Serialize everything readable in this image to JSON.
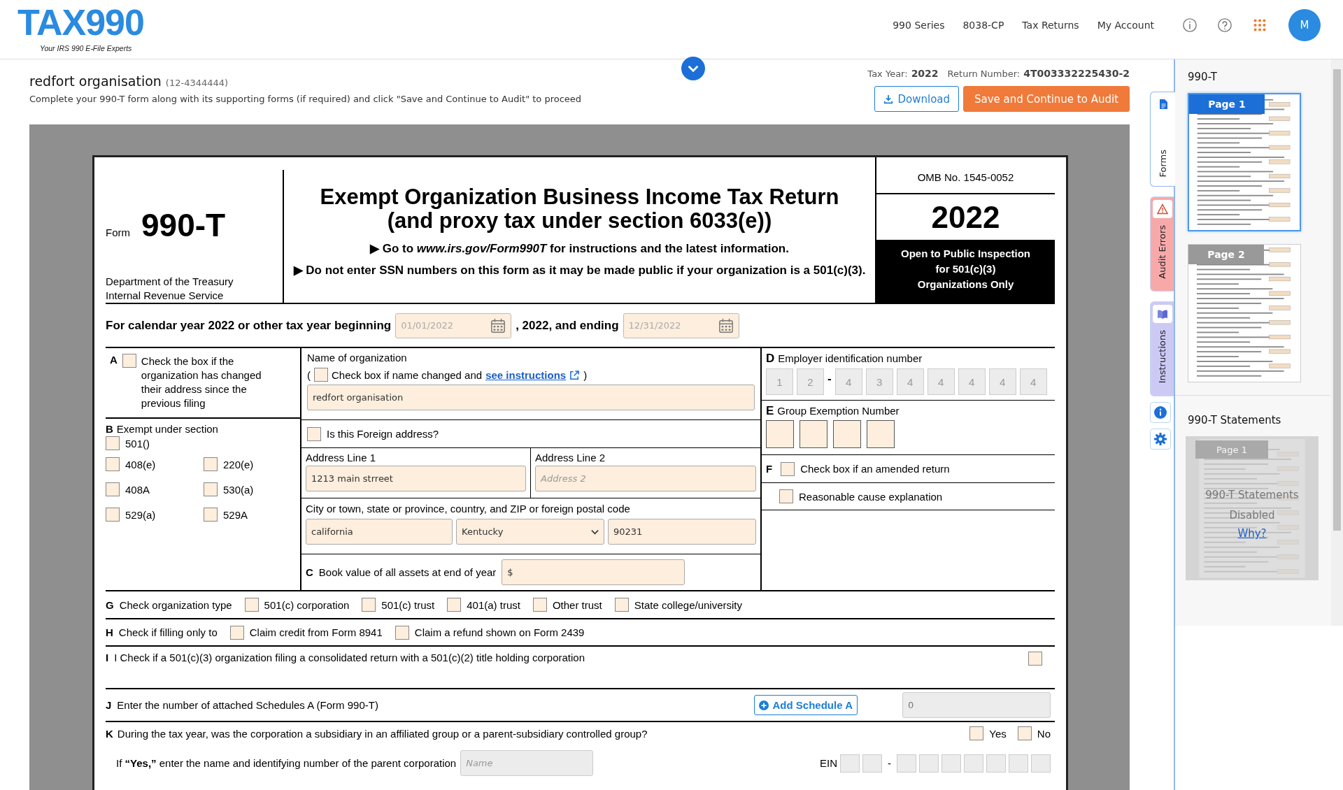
{
  "header": {
    "logo": "TAX990",
    "tagline": "Your IRS 990 E-File Experts",
    "nav": [
      "990 Series",
      "8038-CP",
      "Tax Returns",
      "My Account"
    ],
    "avatar": "M"
  },
  "return": {
    "org_name": "redfort organisation",
    "ein": "(12-4344444)",
    "hint": "Complete your 990-T form along with its supporting forms (if required) and click \"Save and Continue to Audit\" to proceed",
    "tax_year_label": "Tax Year:",
    "tax_year": "2022",
    "return_number_label": "Return Number:",
    "return_number": "4T003332225430-2",
    "buttons": [
      {
        "label": "Download",
        "kind": "outline"
      },
      {
        "label": "Save and Continue to Audit",
        "kind": "primary"
      }
    ]
  },
  "form": {
    "form_label": "Form",
    "form_number": "990-T",
    "department": "Department of the Treasury\nInternal Revenue Service",
    "title": "Exempt Organization Business Income Tax Return\n(and proxy tax under section 6033(e))",
    "goto": "▶ Go to *www.irs.gov/Form990T* for instructions and the latest information.",
    "ssn_note": "▶ Do not enter SSN numbers on this form as it may be made public if your organization is a 501(c)(3).",
    "omb": "OMB No. 1545-0052",
    "year": "2022",
    "inspection": "Open to Public Inspection\nfor 501(c)(3)\nOrganizations Only",
    "dates": {
      "label": "For calendar year 2022 or other tax year beginning",
      "begin": "01/01/2022",
      "middle": ", 2022, and ending",
      "end": "12/31/2022"
    },
    "a": {
      "letter": "A",
      "text": "Check the box if the organization has changed their address since the previous filing",
      "checked": false
    },
    "b": {
      "letter": "B",
      "label": "Exempt under section",
      "options": [
        {
          "label": "501()",
          "checked": false
        },
        {
          "label": "408(e)",
          "checked": false
        },
        {
          "label": "220(e)",
          "checked": false
        },
        {
          "label": "408A",
          "checked": false
        },
        {
          "label": "530(a)",
          "checked": false
        },
        {
          "label": "529(a)",
          "checked": false
        },
        {
          "label": "529A",
          "checked": false
        }
      ]
    },
    "name": {
      "label": "Name of organization",
      "open": "(",
      "text": "Check box if name changed and",
      "link": "see instructions",
      "close": ")",
      "checked": false,
      "value": "redfort organisation"
    },
    "foreign": {
      "text": "Is this Foreign address?",
      "checked": false
    },
    "address1": {
      "label": "Address Line 1",
      "value": "1213 main strreet"
    },
    "address2": {
      "label": "Address Line 2",
      "placeholder": "Address 2"
    },
    "city": {
      "label": "City or town, state or province, country, and ZIP or foreign postal code",
      "city": "california",
      "state": "Kentucky",
      "zip": "90231"
    },
    "c": {
      "letter": "C",
      "label": "Book value of all assets at end of year",
      "value": "$"
    },
    "d": {
      "letter": "D",
      "label": "Employer identification number",
      "digits": [
        "1",
        "2",
        "4",
        "3",
        "4",
        "4",
        "4",
        "4",
        "4"
      ],
      "separator": "-"
    },
    "e": {
      "letter": "E",
      "label": "Group Exemption Number"
    },
    "f": {
      "letter": "F",
      "amended": {
        "text": "Check box if an amended return",
        "checked": false
      },
      "reasonable": {
        "text": "Reasonable cause explanation",
        "checked": false
      }
    },
    "g": {
      "letter": "G",
      "label": "Check organization type",
      "options": [
        {
          "label": "501(c) corporation",
          "checked": false
        },
        {
          "label": "501(c) trust",
          "checked": false
        },
        {
          "label": "401(a) trust",
          "checked": false
        },
        {
          "label": "Other trust",
          "checked": false
        },
        {
          "label": "State college/university",
          "checked": false
        }
      ]
    },
    "h": {
      "letter": "H",
      "label": "Check if filling only to",
      "options": [
        {
          "label": "Claim credit from Form 8941",
          "checked": false
        },
        {
          "label": "Claim a refund shown on Form 2439",
          "checked": false
        }
      ]
    },
    "i": {
      "letter": "I",
      "text": "I Check if a 501(c)(3) organization filing a consolidated return with a 501(c)(2) title holding corporation",
      "checked": false
    },
    "j": {
      "letter": "J",
      "text": "Enter the number of attached Schedules A (Form 990-T)",
      "button": "Add Schedule A",
      "value": "0"
    },
    "k": {
      "letter": "K",
      "question": "During the tax year, was the corporation a subsidiary in an affiliated group or a parent-subsidiary controlled group?",
      "answers": [
        {
          "label": "Yes",
          "checked": false
        },
        {
          "label": "No",
          "checked": false
        }
      ],
      "parent": "If **“Yes,”** enter the name and identifying number of the parent corporation",
      "name_placeholder": "Name",
      "ein_label": "EIN",
      "separator": "-"
    }
  },
  "side_tabs": [
    {
      "label": "Forms",
      "kind": "forms",
      "selected": true,
      "color": "#ffffff"
    },
    {
      "label": "Audit Errors",
      "kind": "errors",
      "selected": false,
      "color": "#f7a9a9"
    },
    {
      "label": "Instructions",
      "kind": "instructions",
      "selected": false,
      "color": "#cdc9f5"
    }
  ],
  "thumbnails": {
    "title": "990-T",
    "pages": [
      {
        "label": "Page 1",
        "selected": true
      },
      {
        "label": "Page 2",
        "selected": false
      }
    ]
  },
  "statements": {
    "title": "990-T Statements",
    "preview_label": "Page 1",
    "message": "990-T Statements Disabled",
    "link": "Why?"
  }
}
